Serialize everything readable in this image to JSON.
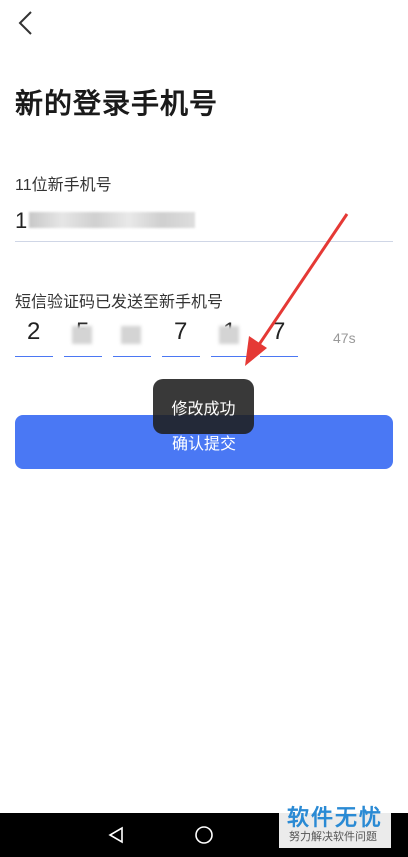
{
  "header": {
    "back_icon": "chevron-left-icon"
  },
  "page_title": "新的登录手机号",
  "phone": {
    "label": "11位新手机号",
    "value_prefix": "1"
  },
  "sms": {
    "label": "短信验证码已发送至新手机号",
    "digits": [
      "2",
      "5",
      "",
      "7",
      "1",
      "7"
    ],
    "countdown": "47s"
  },
  "submit_label": "确认提交",
  "toast_text": "修改成功",
  "navbar": {
    "back_icon": "triangle-back-icon",
    "home_icon": "circle-home-icon"
  },
  "watermark": {
    "main": "软件无忧",
    "sub": "努力解决软件问题"
  },
  "colors": {
    "accent": "#4a78f4",
    "arrow": "#e53935",
    "toast_bg": "#1e1e1e"
  }
}
